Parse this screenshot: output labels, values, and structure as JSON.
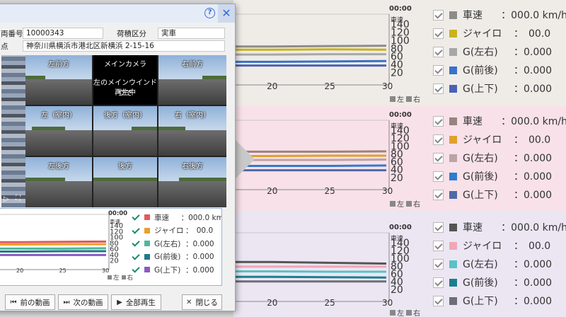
{
  "dialog": {
    "help_icon": "?",
    "close_icon": "✕",
    "vehicle_label": "両番号",
    "vehicle_value": "10000343",
    "cargo_label": "荷積区分",
    "cargo_value": "実車",
    "place_label": "点",
    "place_value": "神奈川県横浜市港北区新横浜 2-15-16",
    "cameras": {
      "front_left": "左前方",
      "main": "メインカメラ",
      "front_right": "右前方",
      "main_msg_1": "左のメインウインドウで",
      "main_msg_2": "再生中",
      "left_in": "左（室内）",
      "rear_in": "後方（室内）",
      "right_in": "右（室内）",
      "rear_left": "左後方",
      "rear": "後方",
      "rear_right": "右後方",
      "ctrl_play": "▷",
      "ctrl_full": "⛶"
    },
    "buttons": {
      "prev": "前の動画",
      "next": "次の動画",
      "play_all": "全部再生",
      "close": "閉じる"
    }
  },
  "chart_common": {
    "time_label": "00:00",
    "speed_label": "車速",
    "y_ticks": [
      "140",
      "120",
      "100",
      "80",
      "60",
      "40",
      "20"
    ],
    "x_ticks": [
      "20",
      "25",
      "30"
    ],
    "lr_left": "左",
    "lr_right": "右"
  },
  "legend_items": {
    "speed": "車速",
    "speed_value": "：000.0 km/h",
    "gyro": "ジャイロ",
    "gyro_value": "：　00.0",
    "g_lr": "G(左右)",
    "g_lr_value": "：0.000",
    "g_fb": "G(前後)",
    "g_fb_value": "：0.000",
    "g_ud": "G(上下)",
    "g_ud_value": "：0.000"
  },
  "panels": {
    "panel1": {
      "bg": "#efece8",
      "colors": [
        "#8c8c8c",
        "#c9b21d",
        "#a7a7a7",
        "#3a72c8",
        "#4a62b5"
      ]
    },
    "panel2": {
      "bg": "#f8e1e8",
      "colors": [
        "#9a8280",
        "#e0a12c",
        "#bba3a6",
        "#2f7bd0",
        "#4f68a6"
      ]
    },
    "panel3": {
      "bg": "#ece6f3",
      "colors": [
        "#555555",
        "#f0a7b6",
        "#58c2c6",
        "#1a7f8e",
        "#6d6d78"
      ]
    },
    "dialog": {
      "bg": "#ffffff",
      "colors": [
        "#e05a5a",
        "#e7a12c",
        "#4fb79a",
        "#1f7a86",
        "#8b59c2"
      ]
    }
  },
  "chart_data": [
    {
      "type": "line",
      "x": [
        20,
        25,
        30
      ],
      "ylim": [
        0,
        140
      ],
      "series": [
        {
          "values": [
            88,
            89,
            90
          ]
        },
        {
          "values": [
            80,
            81,
            80
          ]
        },
        {
          "values": [
            68,
            69,
            69
          ]
        },
        {
          "values": [
            50,
            51,
            52
          ]
        },
        {
          "values": [
            41,
            41,
            41
          ]
        }
      ]
    },
    {
      "type": "line",
      "x": [
        20,
        25,
        30
      ],
      "ylim": [
        0,
        140
      ],
      "series": [
        {
          "values": [
            89,
            89,
            90
          ]
        },
        {
          "values": [
            78,
            79,
            79
          ]
        },
        {
          "values": [
            68,
            68,
            69
          ]
        },
        {
          "values": [
            53,
            53,
            54
          ]
        },
        {
          "values": [
            42,
            42,
            42
          ]
        }
      ]
    },
    {
      "type": "line",
      "x": [
        20,
        25,
        30
      ],
      "ylim": [
        0,
        140
      ],
      "series": [
        {
          "values": [
            94,
            92,
            90
          ]
        },
        {
          "values": [
            82,
            82,
            82
          ]
        },
        {
          "values": [
            70,
            69,
            69
          ]
        },
        {
          "values": [
            56,
            55,
            54
          ]
        },
        {
          "values": [
            44,
            44,
            44
          ]
        }
      ]
    },
    {
      "type": "line",
      "x": [
        20,
        25,
        30
      ],
      "ylim": [
        0,
        140
      ],
      "series": [
        {
          "values": [
            84,
            85,
            86
          ]
        },
        {
          "values": [
            76,
            77,
            77
          ]
        },
        {
          "values": [
            62,
            62,
            63
          ]
        },
        {
          "values": [
            52,
            53,
            53
          ]
        },
        {
          "values": [
            40,
            40,
            40
          ]
        }
      ]
    }
  ]
}
